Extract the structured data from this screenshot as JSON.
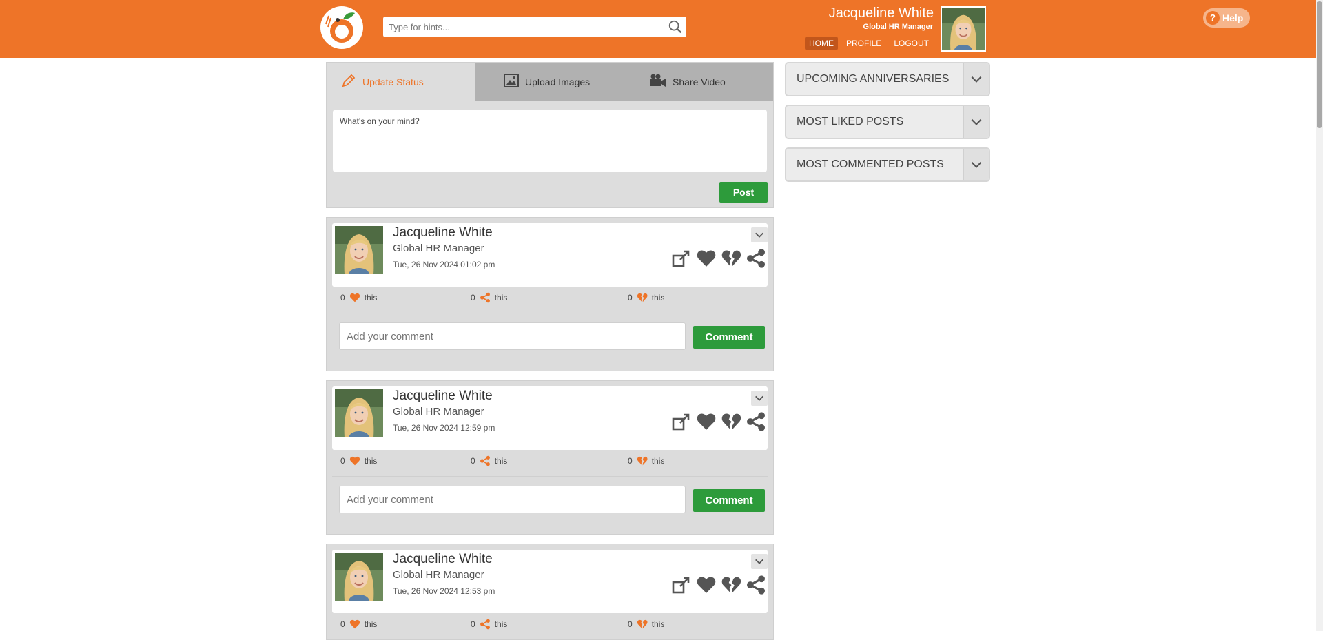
{
  "header": {
    "search_placeholder": "Type for hints...",
    "user_name": "Jacqueline White",
    "user_title": "Global HR Manager",
    "nav": [
      "HOME",
      "PROFILE",
      "LOGOUT"
    ],
    "active_nav": "HOME",
    "help_label": "Help",
    "brand_color": "#ee7428"
  },
  "composer": {
    "tabs": [
      "Update Status",
      "Upload Images",
      "Share Video"
    ],
    "active_tab": "Update Status",
    "placeholder": "What's on your mind?",
    "post_button": "Post"
  },
  "posts": [
    {
      "author": "Jacqueline White",
      "role": "Global HR Manager",
      "timestamp": "Tue, 26 Nov 2024  01:02 pm",
      "likes": "0",
      "likes_label": "this",
      "shares": "0",
      "shares_label": "this",
      "dislikes": "0",
      "dislikes_label": "this",
      "comment_placeholder": "Add your comment",
      "comment_button": "Comment"
    },
    {
      "author": "Jacqueline White",
      "role": "Global HR Manager",
      "timestamp": "Tue, 26 Nov 2024  12:59 pm",
      "likes": "0",
      "likes_label": "this",
      "shares": "0",
      "shares_label": "this",
      "dislikes": "0",
      "dislikes_label": "this",
      "comment_placeholder": "Add your comment",
      "comment_button": "Comment"
    },
    {
      "author": "Jacqueline White",
      "role": "Global HR Manager",
      "timestamp": "Tue, 26 Nov 2024  12:53 pm",
      "likes": "0",
      "likes_label": "this",
      "shares": "0",
      "shares_label": "this",
      "dislikes": "0",
      "dislikes_label": "this"
    }
  ],
  "widgets": [
    "UPCOMING ANNIVERSARIES",
    "MOST LIKED POSTS",
    "MOST COMMENTED POSTS"
  ],
  "icons": {
    "search": "search-icon",
    "pencil": "pencil-icon",
    "image": "image-icon",
    "video": "video-camera-icon",
    "share_out": "share-external-icon",
    "heart": "heart-icon",
    "broken_heart": "broken-heart-icon",
    "share": "share-icon",
    "chevron": "chevron-down-icon"
  }
}
